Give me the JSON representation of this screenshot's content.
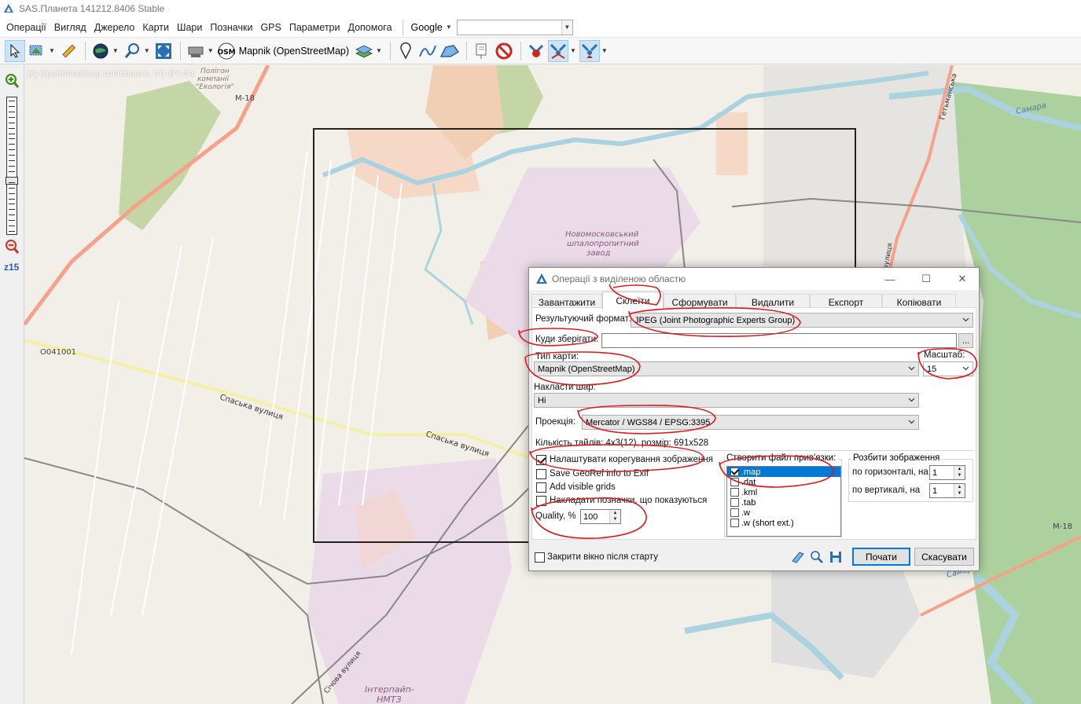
{
  "app": {
    "title": "SAS.Планета 141212.8406 Stable",
    "menu": [
      "Операції",
      "Вигляд",
      "Джерело",
      "Карти",
      "Шари",
      "Позначки",
      "GPS",
      "Параметри",
      "Допомога"
    ],
    "search_provider": "Google",
    "search_value": ""
  },
  "toolbar": {
    "map_source_label": "Mapnik (OpenStreetMap)",
    "osm_badge": "OSM"
  },
  "zoom": {
    "level_label": "z15",
    "slider_level": 15,
    "slider_max": 24
  },
  "map": {
    "attribution": "(c) OpenStreetMap contributors, CC-BY-SA",
    "labels": {
      "road_m18_top": "М-18",
      "road_m18_right": "М-18",
      "road_o041001": "О041001",
      "spaska_1": "Спаська вулиця",
      "spaska_2": "Спаська вулиця",
      "sleeper_plant_1": "Новомосковський",
      "sleeper_plant_2": "шпалопропитний",
      "sleeper_plant_3": "завод",
      "samara_1": "Самара",
      "samara_2": "Самар",
      "ecology_1": "Полігон",
      "ecology_2": "компанії",
      "ecology_3": "\"Екологія\"",
      "hetmanska": "Гетьманська",
      "sichova": "Січова вулиця",
      "interpipe_1": "Інтерпайп-",
      "interpipe_2": "НМТЗ",
      "vulytsia": "вулиця"
    },
    "colors": {
      "background": "#f2efe9",
      "water": "#aad3df",
      "forest": "#add19e",
      "rail": "#999999",
      "road": "#fcd6a4",
      "residential": "#e0dfdf"
    }
  },
  "dialog": {
    "title": "Операції з виділеною областю",
    "tabs": [
      "Завантажити",
      "Склеїти",
      "Сформувати",
      "Видалити",
      "Експорт",
      "Копіювати"
    ],
    "active_tab": "Склеїти",
    "fields": {
      "format_label": "Результуючий формат:",
      "format_value": "JPEG (Joint Photographic Experts Group)",
      "save_label": "Куди зберігати:",
      "save_value": "",
      "browse_label": "...",
      "maptype_label": "Тип карти:",
      "maptype_value": "Mapnik (OpenStreetMap)",
      "scale_label": "Масштаб:",
      "scale_value": "15",
      "overlay_label": "Накласти шар:",
      "overlay_value": "Ні",
      "projection_label": "Проекція:",
      "projection_value": "Mercator / WGS84 / EPSG:3395",
      "tiles_info": "Кількість тайлів: 4x3(12), розмір: 691x528"
    },
    "options": [
      {
        "label": "Налаштувати корегування зображення",
        "checked": true
      },
      {
        "label": "Save GeoRef info to Exif",
        "checked": false
      },
      {
        "label": "Add visible grids",
        "checked": false
      },
      {
        "label": "Накладати позначки, що показуються",
        "checked": false
      }
    ],
    "quality_label": "Quality, %",
    "quality_value": "100",
    "georef_group_title": "Створити файл прив'язки:",
    "georef_items": [
      {
        "label": ".map",
        "checked": true,
        "selected": true
      },
      {
        "label": ".dat",
        "checked": false
      },
      {
        "label": ".kml",
        "checked": false
      },
      {
        "label": ".tab",
        "checked": false
      },
      {
        "label": ".w",
        "checked": false
      },
      {
        "label": ".w (short ext.)",
        "checked": false
      }
    ],
    "split_group_title": "Розбити зображення",
    "split_horizontal_label": "по горизонталі, на",
    "split_horizontal_value": "1",
    "split_vertical_label": "по вертикалі, на",
    "split_vertical_value": "1",
    "close_after_start_label": "Закрити вікно після старту",
    "start_button": "Почати",
    "cancel_button": "Скасувати"
  }
}
